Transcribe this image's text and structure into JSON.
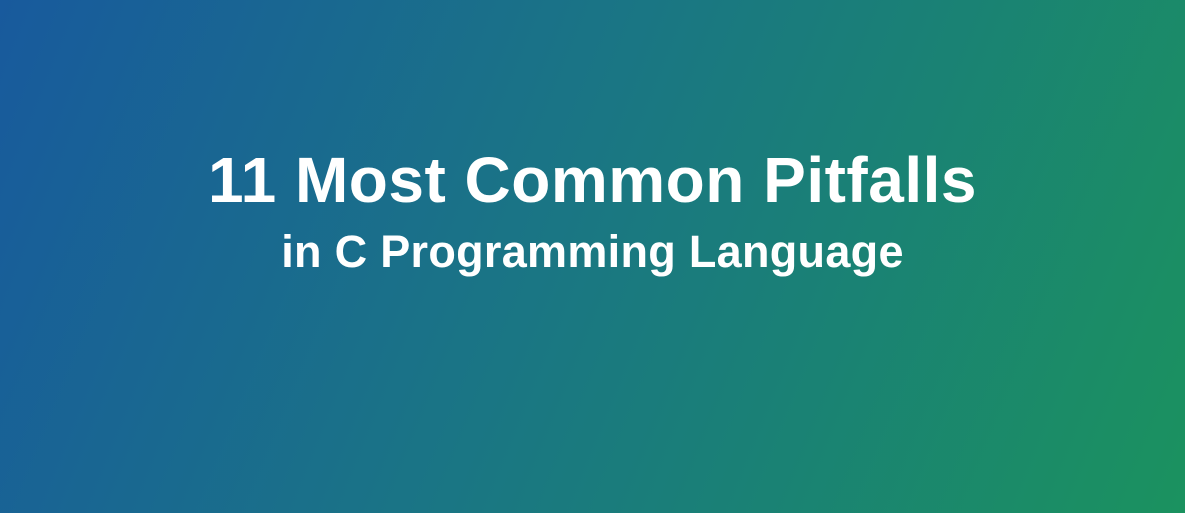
{
  "banner": {
    "title": "11 Most Common Pitfalls",
    "subtitle": "in C Programming Language",
    "gradient_start": "#185a9d",
    "gradient_end": "#1b925f",
    "text_color": "#ffffff"
  }
}
